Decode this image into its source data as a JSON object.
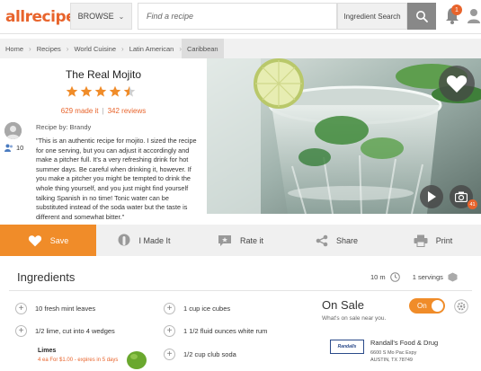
{
  "header": {
    "logo": "allrecipes",
    "browse_label": "BROWSE",
    "search_placeholder": "Find a recipe",
    "search_scope": "Ingredient Search",
    "notification_count": "1"
  },
  "breadcrumb": [
    "Home",
    "Recipes",
    "World Cuisine",
    "Latin American",
    "Caribbean"
  ],
  "recipe": {
    "title": "The Real Mojito",
    "rating": 4.5,
    "made_it": "629 made it",
    "reviews": "342 reviews",
    "recipe_by": "Recipe by: Brandy",
    "followers": "10",
    "description": "\"This is an authentic recipe for mojito. I sized the recipe for one serving, but you can adjust it accordingly and make a pitcher full. It's a very refreshing drink for hot summer days. Be careful when drinking it, however. If you make a pitcher you might be tempted to drink the whole thing yourself, and you just might find yourself talking Spanish in no time! Tonic water can be substituted instead of the soda water but the taste is different and somewhat bitter.\"",
    "photo_count": "41"
  },
  "actions": {
    "save": "Save",
    "made_it": "I Made It",
    "rate": "Rate it",
    "share": "Share",
    "print": "Print"
  },
  "ingredients": {
    "title": "Ingredients",
    "time": "10 m",
    "servings": "1 servings",
    "left": [
      "10 fresh mint leaves",
      "1/2 lime, cut into 4 wedges"
    ],
    "right": [
      "1 cup ice cubes",
      "1 1/2 fluid ounces white rum",
      "1/2 cup club soda"
    ],
    "deal_item": "Limes",
    "deal_text": "4 ea For $1.00 - expires in 5 days"
  },
  "on_sale": {
    "title": "On Sale",
    "subtitle": "What's on sale near you.",
    "toggle_label": "On",
    "store_logo": "Randalls",
    "store_name": "Randall's Food & Drug",
    "store_address_1": "6600 S Mo Pac Expy",
    "store_address_2": "AUSTIN, TX 78749"
  },
  "colors": {
    "accent": "#f08c29",
    "brand": "#e8642c"
  }
}
